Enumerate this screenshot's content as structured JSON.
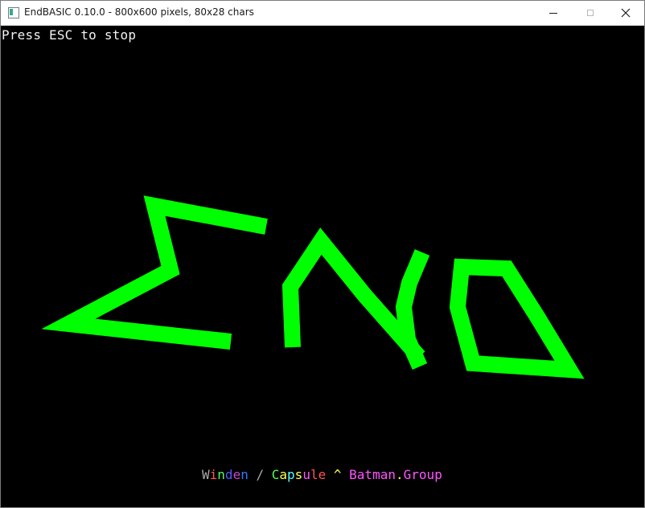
{
  "window": {
    "title": "EndBASIC 0.10.0 - 800x600 pixels, 80x28 chars",
    "controls": {
      "minimize_icon": "minimize-icon",
      "maximize_icon": "maximize-icon",
      "close_icon": "close-icon"
    }
  },
  "console": {
    "background": "#000000",
    "status_text": "Press ESC to stop",
    "status_color": "#f2f2f2"
  },
  "drawing": {
    "color": "#00ff00",
    "description_shapes": [
      "sigma-stroke",
      "lambda-stroke",
      "hook-stroke",
      "delta-stroke"
    ]
  },
  "credits": [
    {
      "text": "W",
      "color": "#aaaaaa"
    },
    {
      "text": "i",
      "color": "#ff5555"
    },
    {
      "text": "n",
      "color": "#55ff55"
    },
    {
      "text": "d",
      "color": "#5555ff"
    },
    {
      "text": "e",
      "color": "#cc44cc"
    },
    {
      "text": "n",
      "color": "#3377ff"
    },
    {
      "text": " / ",
      "color": "#aaaaaa"
    },
    {
      "text": "C",
      "color": "#55ff55"
    },
    {
      "text": "a",
      "color": "#ffff55"
    },
    {
      "text": "p",
      "color": "#55ffff"
    },
    {
      "text": "s",
      "color": "#ffff55"
    },
    {
      "text": "u",
      "color": "#ff55ff"
    },
    {
      "text": "l",
      "color": "#ff5555"
    },
    {
      "text": "e",
      "color": "#ff5555"
    },
    {
      "text": " ^ ",
      "color": "#ffff55"
    },
    {
      "text": "B",
      "color": "#ff55ff"
    },
    {
      "text": "a",
      "color": "#ff55ff"
    },
    {
      "text": "t",
      "color": "#ff55ff"
    },
    {
      "text": "m",
      "color": "#ff55ff"
    },
    {
      "text": "a",
      "color": "#ff55ff"
    },
    {
      "text": "n",
      "color": "#ff55ff"
    },
    {
      "text": ".",
      "color": "#ffff55"
    },
    {
      "text": "G",
      "color": "#ff55ff"
    },
    {
      "text": "r",
      "color": "#ff55ff"
    },
    {
      "text": "o",
      "color": "#ff55ff"
    },
    {
      "text": "u",
      "color": "#ff55ff"
    },
    {
      "text": "p",
      "color": "#ff55ff"
    }
  ]
}
